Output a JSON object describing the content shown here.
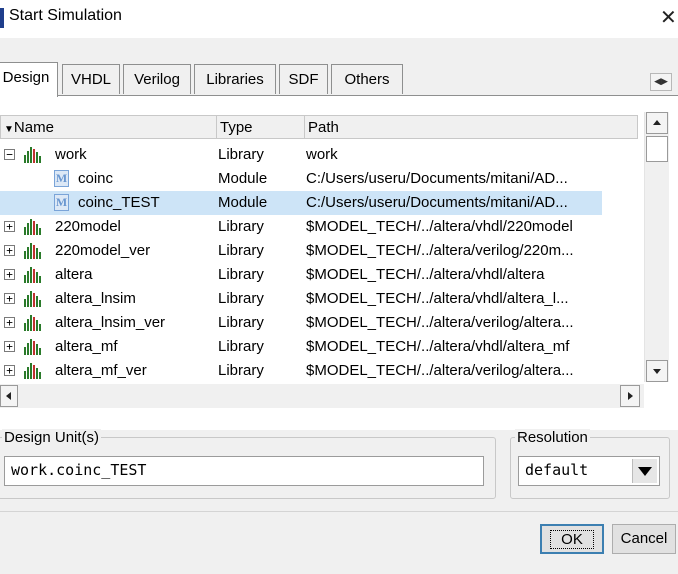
{
  "window": {
    "title": "Start Simulation",
    "close_glyph": "✕"
  },
  "tabs": [
    "Design",
    "VHDL",
    "Verilog",
    "Libraries",
    "SDF",
    "Others"
  ],
  "active_tab": "Design",
  "columns": {
    "name": "Name",
    "type": "Type",
    "path": "Path"
  },
  "rows": [
    {
      "name": "work",
      "type": "Library",
      "path": "work",
      "icon": "library-icon",
      "expander": "−"
    },
    {
      "name": "coinc",
      "type": "Module",
      "path": "C:/Users/useru/Documents/mitani/AD...",
      "icon": "module-icon",
      "icon_letter": "M"
    },
    {
      "name": "coinc_TEST",
      "type": "Module",
      "path": "C:/Users/useru/Documents/mitani/AD...",
      "icon": "module-icon",
      "icon_letter": "M",
      "selected": true
    },
    {
      "name": "220model",
      "type": "Library",
      "path": "$MODEL_TECH/../altera/vhdl/220model",
      "icon": "library-icon",
      "expander": "+"
    },
    {
      "name": "220model_ver",
      "type": "Library",
      "path": "$MODEL_TECH/../altera/verilog/220m...",
      "icon": "library-icon",
      "expander": "+"
    },
    {
      "name": "altera",
      "type": "Library",
      "path": "$MODEL_TECH/../altera/vhdl/altera",
      "icon": "library-icon",
      "expander": "+"
    },
    {
      "name": "altera_lnsim",
      "type": "Library",
      "path": "$MODEL_TECH/../altera/vhdl/altera_l...",
      "icon": "library-icon",
      "expander": "+"
    },
    {
      "name": "altera_lnsim_ver",
      "type": "Library",
      "path": "$MODEL_TECH/../altera/verilog/altera...",
      "icon": "library-icon",
      "expander": "+"
    },
    {
      "name": "altera_mf",
      "type": "Library",
      "path": "$MODEL_TECH/../altera/vhdl/altera_mf",
      "icon": "library-icon",
      "expander": "+"
    },
    {
      "name": "altera_mf_ver",
      "type": "Library",
      "path": "$MODEL_TECH/../altera/verilog/altera...",
      "icon": "library-icon",
      "expander": "+"
    }
  ],
  "design_unit": {
    "label": "Design Unit(s)",
    "value": "work.coinc_TEST"
  },
  "resolution": {
    "label": "Resolution",
    "value": "default"
  },
  "buttons": {
    "ok": "OK",
    "cancel": "Cancel"
  },
  "colors": {
    "selection": "#cde4f7",
    "library_icon": "#2a7a2a",
    "module_icon": "#6a97d0"
  }
}
